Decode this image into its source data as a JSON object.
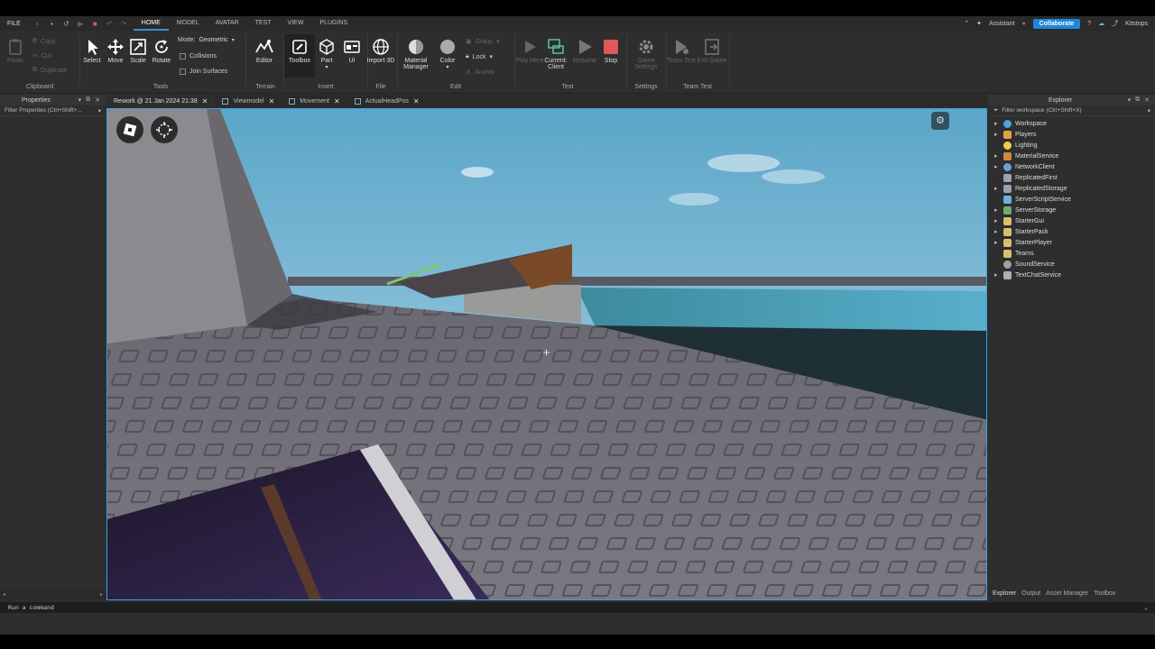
{
  "menu": {
    "file": "FILE",
    "tabs": [
      "HOME",
      "MODEL",
      "AVATAR",
      "TEST",
      "VIEW",
      "PLUGINS"
    ],
    "active_tab": "HOME",
    "assistant": "Assistant",
    "collaborate": "Collaborate",
    "user": "Kitstops"
  },
  "ribbon": {
    "clipboard": {
      "paste": "Paste",
      "copy": "Copy",
      "cut": "Cut",
      "duplicate": "Duplicate",
      "label": "Clipboard"
    },
    "tools": {
      "select": "Select",
      "move": "Move",
      "scale": "Scale",
      "rotate": "Rotate",
      "mode_label": "Mode:",
      "mode_value": "Geometric",
      "collisions": "Collisions",
      "join_surfaces": "Join Surfaces",
      "label": "Tools"
    },
    "terrain": {
      "editor": "Editor",
      "label": "Terrain"
    },
    "insert": {
      "toolbox": "Toolbox",
      "part": "Part",
      "ui": "UI",
      "label": "Insert"
    },
    "file": {
      "import3d": "Import 3D",
      "label": "File"
    },
    "edit": {
      "material": "Material Manager",
      "color": "Color",
      "group": "Group",
      "lock": "Lock",
      "anchor": "Anchor",
      "label": "Edit"
    },
    "test": {
      "play_here": "Play Here",
      "current_client": "Current: Client",
      "resume": "Resume",
      "stop": "Stop",
      "label": "Test"
    },
    "settings": {
      "game_settings": "Game Settings",
      "label": "Settings"
    },
    "team_test": {
      "team_test": "Team Test",
      "exit_game": "Exit Game",
      "label": "Team Test"
    }
  },
  "properties": {
    "title": "Properties",
    "filter_placeholder": "Filter Properties (Ctrl+Shift+..."
  },
  "doc_tabs": [
    {
      "label": "Rework @ 21 Jan 2024 21:38",
      "active": true
    },
    {
      "label": "Viewmodel",
      "active": false
    },
    {
      "label": "Movement",
      "active": false
    },
    {
      "label": "ActualHeadPos",
      "active": false
    }
  ],
  "explorer": {
    "title": "Explorer",
    "filter_placeholder": "Filter workspace (Ctrl+Shift+X)",
    "items": [
      {
        "label": "Workspace",
        "expandable": true,
        "color": "#4aa3df"
      },
      {
        "label": "Players",
        "expandable": true,
        "color": "#e6a23c"
      },
      {
        "label": "Lighting",
        "expandable": false,
        "color": "#f0d040"
      },
      {
        "label": "MaterialService",
        "expandable": true,
        "color": "#d08a3a"
      },
      {
        "label": "NetworkClient",
        "expandable": true,
        "color": "#6aa0d8"
      },
      {
        "label": "ReplicatedFirst",
        "expandable": false,
        "color": "#9aa3ae"
      },
      {
        "label": "ReplicatedStorage",
        "expandable": true,
        "color": "#9aa3ae"
      },
      {
        "label": "ServerScriptService",
        "expandable": false,
        "color": "#6ab0e0"
      },
      {
        "label": "ServerStorage",
        "expandable": true,
        "color": "#6ab06a"
      },
      {
        "label": "StarterGui",
        "expandable": true,
        "color": "#d8c070"
      },
      {
        "label": "StarterPack",
        "expandable": true,
        "color": "#d8c070"
      },
      {
        "label": "StarterPlayer",
        "expandable": true,
        "color": "#d8c070"
      },
      {
        "label": "Teams",
        "expandable": false,
        "color": "#d8c070"
      },
      {
        "label": "SoundService",
        "expandable": false,
        "color": "#a0a0a0"
      },
      {
        "label": "TextChatService",
        "expandable": true,
        "color": "#b0b0b0"
      }
    ],
    "bottom_tabs": [
      "Explorer",
      "Output",
      "Asset Manager",
      "Toolbox"
    ]
  },
  "command_bar": {
    "placeholder": "Run a command"
  },
  "colors": {
    "accent": "#1f87d8",
    "stop": "#e05858",
    "viewport_border": "#3aa0e0"
  }
}
